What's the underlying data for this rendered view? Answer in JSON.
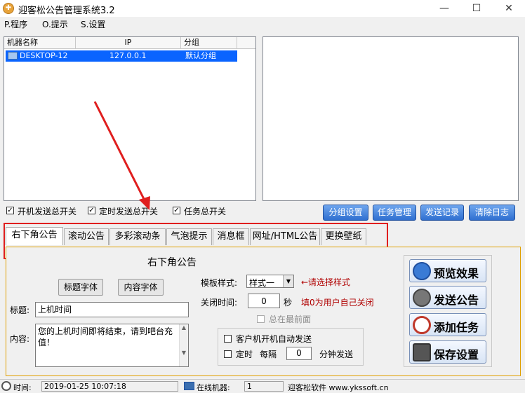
{
  "window": {
    "title": "迎客松公告管理系统3.2",
    "app_icon": "pine-icon",
    "min_glyph": "—",
    "max_glyph": "☐",
    "close_glyph": "✕"
  },
  "menu": [
    "P.程序",
    "O.提示",
    "S.设置"
  ],
  "machine_list": {
    "columns": [
      "机器名称",
      "IP",
      "分组"
    ],
    "rows": [
      {
        "name": "DESKTOP-12",
        "ip": "127.0.0.1",
        "group": "默认分组"
      }
    ]
  },
  "switches": [
    {
      "label": "开机发送总开关",
      "checked": true
    },
    {
      "label": "定时发送总开关",
      "checked": true
    },
    {
      "label": "任务总开关",
      "checked": true
    }
  ],
  "action_buttons": [
    "分组设置",
    "任务管理",
    "发送记录",
    "清除日志"
  ],
  "tabs": [
    "右下角公告",
    "滚动公告",
    "多彩滚动条",
    "气泡提示",
    "消息框",
    "网址/HTML公告",
    "更换壁纸"
  ],
  "active_tab": "右下角公告",
  "panel": {
    "heading": "右下角公告",
    "title_font_button": "标题字体",
    "content_font_button": "内容字体",
    "title_label": "标题:",
    "title_value": "上机时间",
    "content_label": "内容:",
    "content_value": "您的上机时间即将结束，请到吧台充值！",
    "template_label": "模板样式:",
    "template_value": "样式一",
    "template_hint": "←请选择样式",
    "close_time_label": "关闭时间:",
    "close_time_value": "0",
    "close_time_unit": "秒",
    "close_time_hint": "填0为用户自己关闭",
    "always_top_label": "总在最前面",
    "auto_send_label": "客户机开机自动发送",
    "timed_label": "定时",
    "every_label": "每隔",
    "every_value": "0",
    "every_unit": "分钟发送"
  },
  "side_buttons": [
    {
      "label": "预览效果",
      "icon": "magnifier-icon",
      "color": "#3a7bd5"
    },
    {
      "label": "发送公告",
      "icon": "speaker-icon",
      "color": "#555555"
    },
    {
      "label": "添加任务",
      "icon": "clock-icon",
      "color": "#c0392b"
    },
    {
      "label": "保存设置",
      "icon": "floppy-icon",
      "color": "#444444"
    }
  ],
  "status": {
    "time_label": "时间:",
    "time_value": "2019-01-25 10:07:18",
    "online_label": "在线机器:",
    "online_value": "1",
    "brand": "迎客松软件 www.ykssoft.cn"
  },
  "colors": {
    "accent_blue": "#0a64ff",
    "annotation_red": "#e01e1e",
    "hint_red": "#b00000"
  }
}
